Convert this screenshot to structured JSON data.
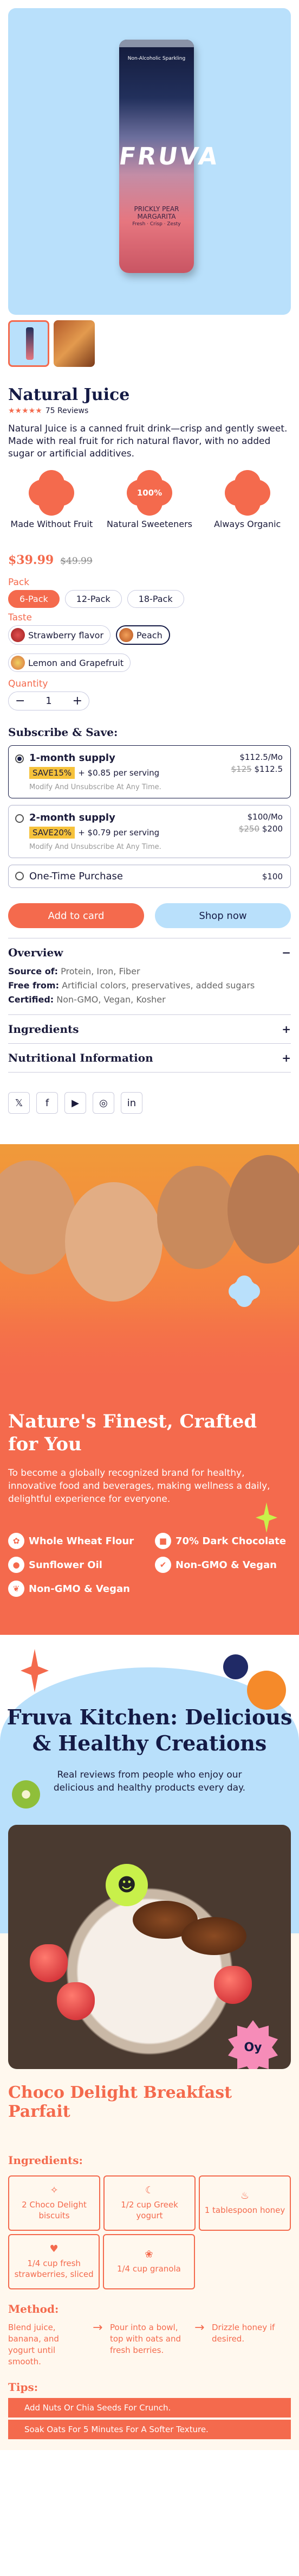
{
  "product": {
    "can": {
      "brand": "FRUVA",
      "tagline": "Non-Alcoholic Sparkling",
      "flavor_line1": "PRICKLY PEAR",
      "flavor_line2": "MARGARITA",
      "flavor_line3": "Fresh · Crisp · Zesty"
    },
    "title": "Natural Juice",
    "rating_stars": "★★★★★",
    "reviews": "75 Reviews",
    "description": "Natural Juice is a canned fruit drink—crisp and gently sweet. Made with real fruit for rich natural flavor, with no added sugar or artificial additives.",
    "badges": [
      {
        "icon": "",
        "label": "Made Without Fruit"
      },
      {
        "icon": "100%",
        "label": "Natural Sweeteners"
      },
      {
        "icon": "",
        "label": "Always Organic"
      }
    ],
    "price": "$39.99",
    "compare_price": "$49.99",
    "pack_label": "Pack",
    "packs": [
      "6-Pack",
      "12-Pack",
      "18-Pack"
    ],
    "taste_label": "Taste",
    "tastes": [
      "Strawberry flavor",
      "Peach",
      "Lemon and Grapefruit"
    ],
    "quantity_label": "Quantity",
    "quantity": "1"
  },
  "subscribe": {
    "title": "Subscribe & Save:",
    "plans": [
      {
        "name": "1-month supply",
        "save": "SAVE15%",
        "extra": "+ $0.85 per serving",
        "fine": "Modify And Unsubscribe At Any Time.",
        "price": "$112.5/Mo",
        "was": "$125",
        "now": "$112.5"
      },
      {
        "name": "2-month supply",
        "save": "SAVE20%",
        "extra": "+ $0.79 per serving",
        "fine": "Modify And Unsubscribe At Any Time.",
        "price": "$100/Mo",
        "was": "$250",
        "now": "$200"
      }
    ],
    "one_time": {
      "name": "One-Time Purchase",
      "price": "$100"
    }
  },
  "actions": {
    "add": "Add to card",
    "shop": "Shop now"
  },
  "accordion": {
    "overview": "Overview",
    "source_k": "Source of:",
    "source_v": "Protein, Iron, Fiber",
    "free_k": "Free from:",
    "free_v": "Artificial colors, preservatives, added sugars",
    "cert_k": "Certified:",
    "cert_v": "Non-GMO, Vegan, Kosher",
    "ingredients": "Ingredients",
    "nutrition": "Nutritional Information"
  },
  "social": [
    "𝕏",
    "f",
    "▶",
    "◎",
    "in"
  ],
  "nature": {
    "title": "Nature's Finest, Crafted for You",
    "text": "To become a globally recognized brand for healthy, innovative food and beverages, making wellness a daily, delightful experience for everyone.",
    "features": [
      "Whole Wheat Flour",
      "70% Dark Chocolate",
      "Sunflower Oil",
      "Non-GMO & Vegan",
      "Non-GMO & Vegan"
    ]
  },
  "kitchen": {
    "title": "Fruva Kitchen: Delicious & Healthy Creations",
    "text": "Real reviews from people who enjoy our delicious and healthy products every day."
  },
  "recipe": {
    "sticker": "Oy",
    "title": "Choco Delight Breakfast Parfait",
    "ingredients_label": "Ingredients:",
    "ingredients": [
      "2 Choco Delight biscuits",
      "1/2 cup Greek yogurt",
      "1 tablespoon honey",
      "1/4 cup fresh strawberries, sliced",
      "1/4 cup granola"
    ],
    "method_label": "Method:",
    "method": [
      "Blend juice, banana, and yogurt until smooth.",
      "Pour into a bowl, top with oats and fresh berries.",
      "Drizzle honey if desired."
    ],
    "tips_label": "Tips:",
    "tips": [
      "Add Nuts Or Chia Seeds For Crunch.",
      "Soak Oats For 5 Minutes For A Softer Texture."
    ]
  }
}
